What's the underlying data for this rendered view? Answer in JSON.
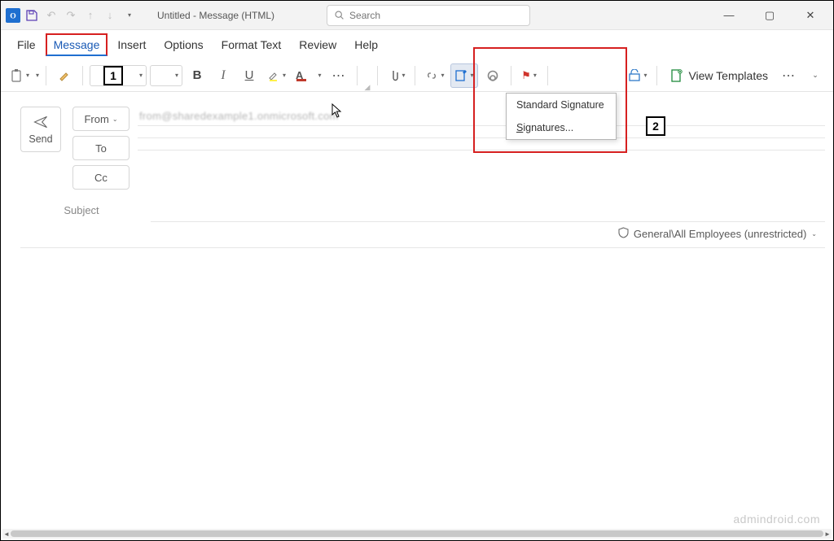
{
  "titlebar": {
    "app_letter": "O",
    "title": "Untitled  -  Message (HTML)",
    "search_placeholder": "Search"
  },
  "tabs": {
    "file": "File",
    "message": "Message",
    "insert": "Insert",
    "options": "Options",
    "format_text": "Format Text",
    "review": "Review",
    "help": "Help"
  },
  "ribbon": {
    "view_templates": "View Templates"
  },
  "signature_menu": {
    "item1": "Standard Signature",
    "item2": "Signatures..."
  },
  "callouts": {
    "one": "1",
    "two": "2"
  },
  "compose": {
    "send": "Send",
    "from": "From",
    "to": "To",
    "cc": "Cc",
    "from_value": "from@sharedexample1.onmicrosoft.com",
    "subject_label": "Subject",
    "classification": "General\\All Employees (unrestricted)"
  },
  "watermark": "admindroid.com"
}
